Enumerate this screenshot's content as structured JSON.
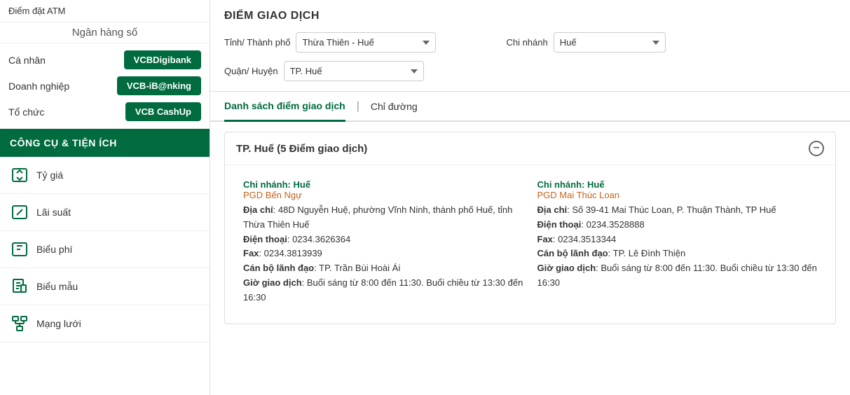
{
  "sidebar": {
    "atm_label": "Điểm đặt ATM",
    "digital_bank_label": "Ngân hàng số",
    "accounts": [
      {
        "id": "ca-nhan",
        "label": "Cá nhân",
        "btn": "VCBDigibank"
      },
      {
        "id": "doanh-nghiep",
        "label": "Doanh nghiệp",
        "btn": "VCB-iB@nking"
      },
      {
        "id": "to-chuc",
        "label": "Tổ chức",
        "btn": "VCB CashUp"
      }
    ],
    "tools_header": "CÔNG CỤ & TIỆN ÍCH",
    "tools": [
      {
        "id": "ty-gia",
        "label": "Tỷ giá",
        "icon": "exchange"
      },
      {
        "id": "lai-suat",
        "label": "Lãi suất",
        "icon": "percent"
      },
      {
        "id": "bieu-phi",
        "label": "Biểu phí",
        "icon": "tag"
      },
      {
        "id": "bieu-mau",
        "label": "Biểu mẫu",
        "icon": "doc"
      },
      {
        "id": "mang-luoi",
        "label": "Mạng lưới",
        "icon": "network"
      }
    ]
  },
  "main": {
    "dgd": {
      "title": "ĐIỂM GIAO DỊCH",
      "tinh_label": "Tỉnh/ Thành phố",
      "tinh_value": "Thừa Thiên - Huế",
      "quan_label": "Quận/ Huyện",
      "quan_value": "TP. Huế",
      "chi_nhanh_label": "Chi nhánh",
      "chi_nhanh_value": "Huế"
    },
    "tabs": [
      {
        "id": "danh-sach",
        "label": "Danh sách điểm giao dịch",
        "active": true
      },
      {
        "id": "chi-duong",
        "label": "Chỉ đường",
        "active": false
      }
    ],
    "tab_separator": "|",
    "location_group": {
      "title": "TP. Huế (5 Điểm giao dịch)",
      "branches": [
        {
          "chi_nhanh": "Chi nhánh: Huế",
          "pgd": "PGD Bến Ngự",
          "dia_chi_label": "Địa chỉ",
          "dia_chi": "48D Nguyễn Huệ, phường Vĩnh Ninh, thành phố Huế, tỉnh Thừa Thiên Huế",
          "dt_label": "Điện thoại",
          "dt": "0234.3626364",
          "fax_label": "Fax",
          "fax": "0234.3813939",
          "cb_label": "Cán bộ lãnh đạo",
          "cb": "TP. Trần Bùi Hoài Ái",
          "gio_label": "Giờ giao dịch",
          "gio": "Buổi sáng từ 8:00 đến 11:30. Buổi chiều từ 13:30 đến 16:30"
        },
        {
          "chi_nhanh": "Chi nhánh: Huế",
          "pgd": "PGD Mai Thúc Loan",
          "dia_chi_label": "Địa chỉ",
          "dia_chi": "Số 39-41 Mai Thúc Loan, P. Thuận Thành, TP Huế",
          "dt_label": "Điện thoại",
          "dt": "0234.3528888",
          "fax_label": "Fax",
          "fax": "0234.3513344",
          "cb_label": "Cán bộ lãnh đạo",
          "cb": "TP. Lê Đình Thiện",
          "gio_label": "Giờ giao dịch",
          "gio": "Buổi sáng từ 8:00 đến 11:30. Buổi chiều từ 13:30 đến 16:30"
        }
      ]
    }
  },
  "colors": {
    "green": "#006B3F",
    "orange": "#c9631c"
  }
}
